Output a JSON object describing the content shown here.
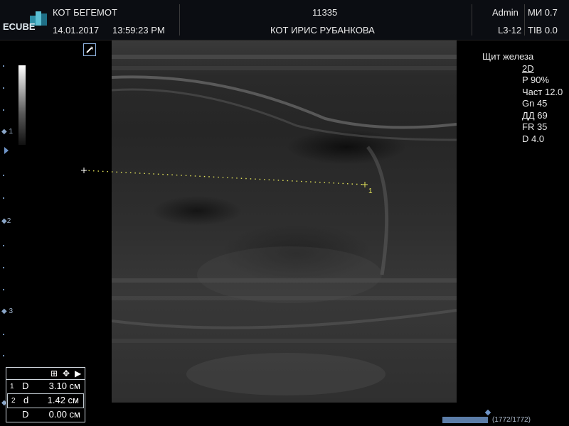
{
  "header": {
    "logo_text": "ECUBE",
    "patient_name": "КОТ БЕГЕМОТ",
    "date": "14.01.2017",
    "time": "13:59:23 PM",
    "study_id": "11335",
    "owner": "КОТ ИРИС РУБАНКОВА",
    "user": "Admin",
    "mi": "МИ 0.7",
    "probe": "L3-12",
    "tib": "TIB 0.0"
  },
  "params": {
    "preset": "Щит железа",
    "mode": "2D",
    "power": "P 90%",
    "freq": "Част 12.0",
    "gain": "Gn 45",
    "dynamic_range": "ДД 69",
    "frame_rate": "FR 35",
    "depth": "D 4.0"
  },
  "ruler": {
    "labels": [
      "1",
      "2",
      "3"
    ]
  },
  "caliper": {
    "label": "1",
    "color": "#e6e65a"
  },
  "measurements": {
    "rows": [
      {
        "index": "1",
        "label": "D",
        "value": "3.10 см"
      },
      {
        "index": "2",
        "label": "d",
        "value": "1.42 см"
      },
      {
        "index": "",
        "label": "D",
        "value": "0.00 см"
      }
    ]
  },
  "cine": {
    "frame_count": "(1772/1772)",
    "progress": 1.0
  },
  "icons": {
    "logo": "ecube-logo-icon",
    "cursor": "pointer-cursor-icon",
    "grid": "grid-icon",
    "move": "move-arrows-icon",
    "play": "play-icon",
    "marker": "diamond-marker-icon"
  },
  "colors": {
    "accent": "#6f95c8",
    "caliper": "#e6e65a",
    "background": "#000000"
  }
}
